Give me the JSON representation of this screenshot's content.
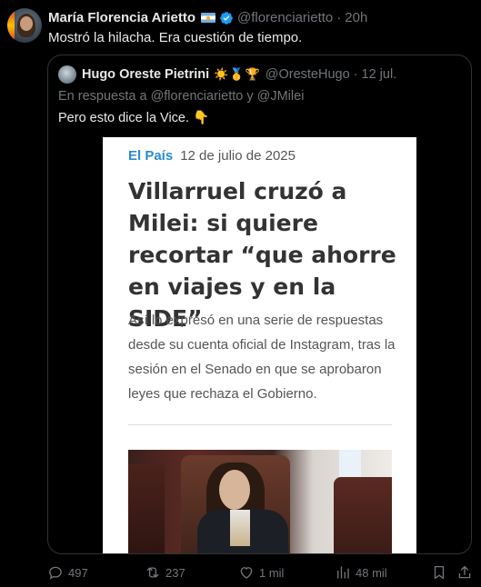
{
  "tweet": {
    "author_name": "María Florencia Arietto",
    "handle": "@florenciarietto",
    "separator": "·",
    "time": "20h",
    "text": "Mostró la hilacha. Era cuestión de tiempo."
  },
  "quote": {
    "author_name": "Hugo Oreste Pietrini",
    "emojis": "☀️🥇🏆",
    "handle": "@OresteHugo",
    "separator": "·",
    "time": "12 jul.",
    "reply_to": "En respuesta a @florenciarietto y @JMilei",
    "text": "Pero esto dice la Vice. 👇",
    "article": {
      "publication": "El País",
      "date": "12 de julio de 2025",
      "headline": "Villarruel cruzó a Milei: si quiere recortar “que ahorre en viajes y en la SIDE”",
      "lede": "Así lo expresó en una serie de respuestas desde su cuenta oficial de Instagram, tras la sesión en el Senado en que se aprobaron leyes que rechaza el Gobierno."
    }
  },
  "actions": {
    "replies": "497",
    "retweets": "237",
    "likes": "1 mil",
    "views": "48 mil"
  },
  "colors": {
    "background": "#000000",
    "text": "#e7e9ea",
    "muted": "#71767b",
    "verified": "#1d9bf0",
    "border": "#2f3336"
  },
  "icons": [
    "reply-icon",
    "retweet-icon",
    "like-icon",
    "views-icon",
    "bookmark-icon",
    "share-icon",
    "verified-badge-icon",
    "argentina-flag-icon"
  ]
}
